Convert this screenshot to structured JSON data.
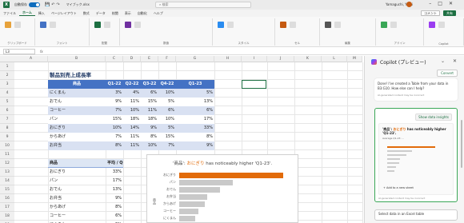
{
  "titlebar": {
    "autosave_label": "自動保存",
    "autosave_state": "オン",
    "filename": "マイブック.xlsx",
    "search_placeholder": "検索",
    "user_name": "Yamaguchi, Yoshi"
  },
  "menu": {
    "items": [
      "ファイル",
      "ホーム",
      "挿入",
      "ページレイアウト",
      "数式",
      "データ",
      "校閲",
      "表示",
      "自動化",
      "ヘルプ"
    ],
    "active_index": 1,
    "comments_label": "コメント",
    "share_label": "共有"
  },
  "ribbon": {
    "groups": [
      "クリップボード",
      "フォント",
      "配置",
      "数値",
      "スタイル",
      "セル",
      "編集",
      "アドイン",
      "Copilot"
    ]
  },
  "formula": {
    "namebox": "L3",
    "fx": "fx"
  },
  "grid": {
    "columns": [
      "A",
      "B",
      "C",
      "D",
      "E",
      "F",
      "G",
      "H",
      "I",
      "J",
      "K",
      "L",
      "M"
    ],
    "rows": [
      "1",
      "2",
      "3",
      "4",
      "5",
      "6",
      "7",
      "8",
      "9",
      "10",
      "11",
      "12",
      "13",
      "14",
      "15",
      "16",
      "17",
      "18",
      "19"
    ]
  },
  "table1": {
    "title": "製品別売上成長率",
    "headers": [
      "商品",
      "Q1-22",
      "Q2-22",
      "Q3-22",
      "Q4-22",
      "Q1-23"
    ],
    "rows": [
      [
        "にくまん",
        "3%",
        "4%",
        "6%",
        "10%",
        "5%"
      ],
      [
        "おでん",
        "9%",
        "11%",
        "15%",
        "5%",
        "13%"
      ],
      [
        "コーヒー",
        "7%",
        "10%",
        "11%",
        "6%",
        "6%"
      ],
      [
        "パン",
        "15%",
        "18%",
        "18%",
        "10%",
        "17%"
      ],
      [
        "おにぎり",
        "10%",
        "14%",
        "9%",
        "5%",
        "33%"
      ],
      [
        "からあげ",
        "7%",
        "11%",
        "8%",
        "15%",
        "8%"
      ],
      [
        "お弁当",
        "8%",
        "11%",
        "10%",
        "7%",
        "9%"
      ]
    ]
  },
  "table2": {
    "headers": [
      "商品",
      "平均 / Q1-23"
    ],
    "rows": [
      [
        "おにぎり",
        "33%"
      ],
      [
        "パン",
        "17%"
      ],
      [
        "おでん",
        "13%"
      ],
      [
        "お弁当",
        "9%"
      ],
      [
        "からあげ",
        "8%"
      ],
      [
        "コーヒー",
        "6%"
      ],
      [
        "にくまん",
        "5%"
      ]
    ]
  },
  "chart_data": {
    "type": "bar",
    "title_prefix": "'商品': ",
    "title_highlight": "おにぎり",
    "title_suffix": " has noticeably higher 'Q1-23'.",
    "ylabel": "商品",
    "categories": [
      "おにぎり",
      "パン",
      "おでん",
      "お弁当",
      "からあげ",
      "コーヒー",
      "にくまん"
    ],
    "values": [
      33,
      17,
      13,
      9,
      8,
      6,
      5
    ],
    "highlight_color": "#e26b0a",
    "base_color": "#c9c9c9"
  },
  "copilot": {
    "title": "Copilot (プレビュー)",
    "convert_label": "Convert",
    "message": "Done! I've created a Table from your data in B3:G10. How else can I help?",
    "message_footer": "AI-generated content may be incorrect",
    "card_button": "Show data insights",
    "card_title_prefix": "'商品': ",
    "card_title_highlight": "おにぎり",
    "card_title_suffix": " has noticeably higher 'Q1-23'.",
    "card_sub": "Average Q1-23: ...",
    "add_link": "+ Add to a new sheet",
    "card_footer": "AI-generated content may be incorrect",
    "bottom_text": "Select data in an Excel table"
  },
  "colors": {
    "excel_green": "#1d6f42",
    "table_header": "#4472c4",
    "table_band": "#d9e1f2",
    "accent_orange": "#e26b0a",
    "copilot_border": "#3aa757"
  }
}
